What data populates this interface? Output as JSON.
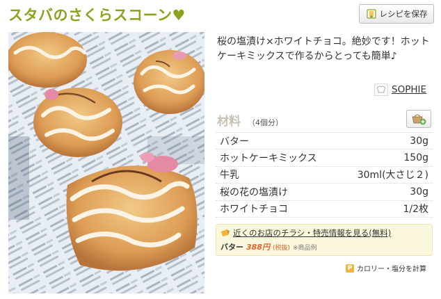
{
  "title": "スタバのさくらスコーン",
  "save_button": {
    "label": "レシピを保存"
  },
  "description": "桜の塩漬け×ホワイトチョコ。絶妙です！ホットケーキミックスで作るからとっても簡単♪",
  "author": {
    "name": "SOPHIE"
  },
  "ingredients": {
    "heading": "材料",
    "servings": "（4個分）",
    "items": [
      {
        "name": "バター",
        "amount": "30g"
      },
      {
        "name": "ホットケーキミックス",
        "amount": "150g"
      },
      {
        "name": "牛乳",
        "amount": "30ml(大さじ２)"
      },
      {
        "name": "桜の花の塩漬け",
        "amount": "30g"
      },
      {
        "name": "ホワイトチョコ",
        "amount": "1/2枚"
      }
    ]
  },
  "shop_info": {
    "link_text": "近くのお店のチラシ・特売情報を見る(無料)",
    "item": "バター",
    "price": "388円",
    "tax": "(税抜)",
    "note": "※商品例"
  },
  "calorie_button": {
    "label": "カロリー・塩分を計算"
  },
  "colors": {
    "title": "#8aa31c",
    "price": "#e3632b",
    "shop_bg": "#fbf7dc"
  },
  "icons": {
    "heart": "heart-icon",
    "save": "bookmark-icon",
    "chef": "chef-hat-icon",
    "cart": "basket-add-icon",
    "shop": "flyer-icon",
    "calorie": "calculator-icon"
  }
}
